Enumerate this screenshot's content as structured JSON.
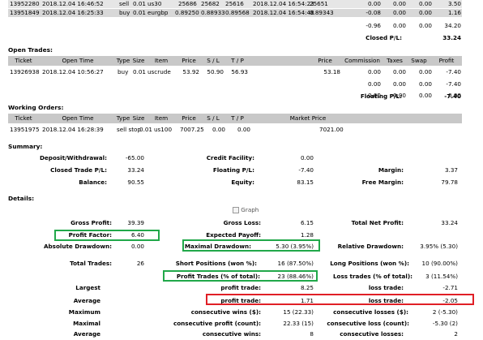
{
  "closed_trades": {
    "rows": [
      {
        "ticket": "13952280",
        "open_time": "2018.12.04 16:46:52",
        "type": "sell",
        "size": "0.01",
        "item": "us30",
        "price": "25686",
        "sl": "25682",
        "tp": "25616",
        "close_time": "2018.12.04 16:54:23",
        "close_price": "25651",
        "commission": "0.00",
        "taxes": "0.00",
        "swap": "0.00",
        "profit": "3.50"
      },
      {
        "ticket": "13951849",
        "open_time": "2018.12.04 16:25:33",
        "type": "buy",
        "size": "0.01",
        "item": "eurgbp",
        "price": "0.89250",
        "sl": "0.88933",
        "tp": "0.89568",
        "close_time": "2018.12.04 16:54:48",
        "close_price": "0.89343",
        "commission": "-0.08",
        "taxes": "0.00",
        "swap": "0.00",
        "profit": "1.16"
      }
    ],
    "totals": {
      "commission": "-0.96",
      "taxes": "0.00",
      "swap": "0.00",
      "profit": "34.20"
    },
    "closed_pl_label": "Closed P/L:",
    "closed_pl_value": "33.24"
  },
  "open_trades": {
    "title": "Open Trades:",
    "headers": [
      "Ticket",
      "Open Time",
      "Type",
      "Size",
      "Item",
      "Price",
      "S / L",
      "T / P",
      "",
      "Price",
      "Commission",
      "Taxes",
      "Swap",
      "Profit"
    ],
    "row": {
      "ticket": "13926938",
      "open_time": "2018.12.04 10:56:27",
      "type": "buy",
      "size": "0.01",
      "item": "uscrude",
      "price": "53.92",
      "sl": "50.90",
      "tp": "56.93",
      "cur_price": "53.18",
      "commission": "0.00",
      "taxes": "0.00",
      "swap": "0.00",
      "profit": "-7.40"
    },
    "sub1": {
      "commission": "0.00",
      "taxes": "0.00",
      "swap": "0.00",
      "profit": "-7.40"
    },
    "sub2": {
      "commission": "0.00",
      "taxes": "0.00",
      "swap": "0.00",
      "profit": "0.00"
    },
    "floating_label": "Floating P/L:",
    "floating_value": "-7.40"
  },
  "working_orders": {
    "title": "Working Orders:",
    "headers": [
      "Ticket",
      "Open Time",
      "Type",
      "Size",
      "Item",
      "Price",
      "S / L",
      "T / P",
      "Market Price"
    ],
    "row": {
      "ticket": "13951975",
      "open_time": "2018.12.04 16:28:39",
      "type": "sell stop",
      "size": "0.01",
      "item": "us100",
      "price": "7007.25",
      "sl": "0.00",
      "tp": "0.00",
      "market_price": "7021.00"
    }
  },
  "summary": {
    "title": "Summary:",
    "deposit_label": "Deposit/Withdrawal:",
    "deposit": "-65.00",
    "credit_label": "Credit Facility:",
    "credit": "0.00",
    "closed_label": "Closed Trade P/L:",
    "closed": "33.24",
    "floating_label": "Floating P/L:",
    "floating": "-7.40",
    "margin_label": "Margin:",
    "margin": "3.37",
    "balance_label": "Balance:",
    "balance": "90.55",
    "equity_label": "Equity:",
    "equity": "83.15",
    "free_margin_label": "Free Margin:",
    "free_margin": "79.78"
  },
  "details": {
    "title": "Details:",
    "graph_alt": "Graph",
    "gross_profit_label": "Gross Profit:",
    "gross_profit": "39.39",
    "gross_loss_label": "Gross Loss:",
    "gross_loss": "6.15",
    "total_net_label": "Total Net Profit:",
    "total_net": "33.24",
    "profit_factor_label": "Profit Factor:",
    "profit_factor": "6.40",
    "expected_payoff_label": "Expected Payoff:",
    "expected_payoff": "1.28",
    "abs_dd_label": "Absolute Drawdown:",
    "abs_dd": "0.00",
    "max_dd_label": "Maximal Drawdown:",
    "max_dd": "5.30 (3.95%)",
    "rel_dd_label": "Relative Drawdown:",
    "rel_dd": "3.95% (5.30)",
    "total_trades_label": "Total Trades:",
    "total_trades": "26",
    "short_pos_label": "Short Positions (won %):",
    "short_pos": "16 (87.50%)",
    "long_pos_label": "Long Positions (won %):",
    "long_pos": "10 (90.00%)",
    "profit_trades_label": "Profit Trades (% of total):",
    "profit_trades": "23 (88.46%)",
    "loss_trades_label": "Loss trades (% of total):",
    "loss_trades": "3 (11.54%)",
    "largest_label": "Largest",
    "largest_profit_label": "profit trade:",
    "largest_profit": "8.25",
    "largest_loss_label": "loss trade:",
    "largest_loss": "-2.71",
    "average_label": "Average",
    "average_profit_label": "profit trade:",
    "average_profit": "1.71",
    "average_loss_label": "loss trade:",
    "average_loss": "-2.05",
    "maximum_label": "Maximum",
    "max_cons_wins_label": "consecutive wins ($):",
    "max_cons_wins": "15 (22.33)",
    "max_cons_losses_label": "consecutive losses ($):",
    "max_cons_losses": "2 (-5.30)",
    "maximal_label": "Maximal",
    "maxl_cons_profit_label": "consecutive profit (count):",
    "maxl_cons_profit": "22.33 (15)",
    "maxl_cons_loss_label": "consecutive loss (count):",
    "maxl_cons_loss": "-5.30 (2)",
    "avg2_label": "Average",
    "avg_cons_wins_label": "consecutive wins:",
    "avg_cons_wins": "8",
    "avg_cons_losses_label": "consecutive losses:",
    "avg_cons_losses": "2"
  }
}
